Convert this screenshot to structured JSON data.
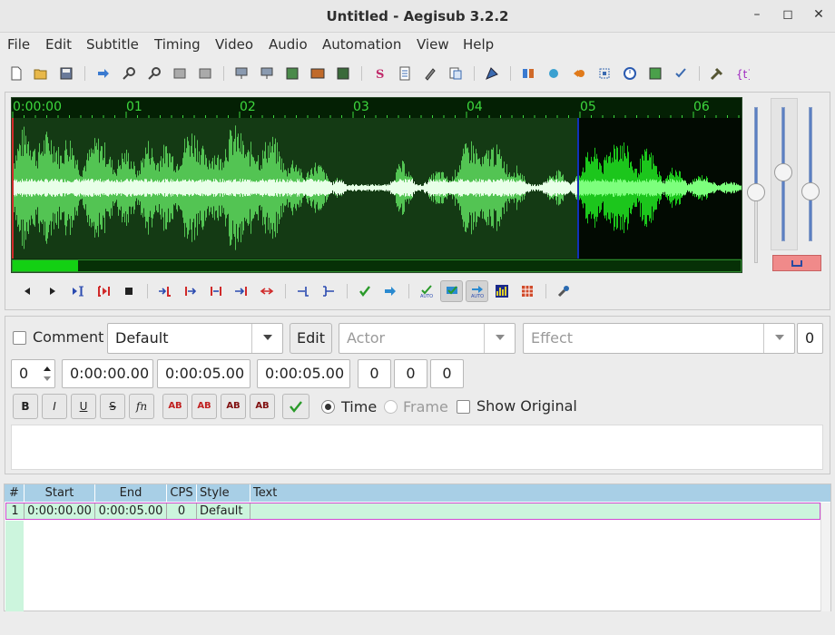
{
  "window": {
    "title": "Untitled - Aegisub 3.2.2"
  },
  "menu": [
    "File",
    "Edit",
    "Subtitle",
    "Timing",
    "Video",
    "Audio",
    "Automation",
    "View",
    "Help"
  ],
  "timeline": {
    "labels": [
      "0:00:00",
      "01",
      "02",
      "03",
      "04",
      "05",
      "06"
    ],
    "scroll_fraction": 0.09
  },
  "colors": {
    "waveform_bg": "#0b2f0b",
    "waveform_selected": "#53c453",
    "waveform_unselected": "#1cc61c",
    "marker": "#1230b8",
    "grid_header": "#a8cfe6",
    "grid_row": "#ccf5dd",
    "row_border": "#d04ad0"
  },
  "edit": {
    "comment_label": "Comment",
    "style_value": "Default",
    "edit_button": "Edit",
    "actor_placeholder": "Actor",
    "effect_placeholder": "Effect",
    "layer_value": "0",
    "line_value": "0",
    "start_time": "0:00:00.00",
    "end_time": "0:00:05.00",
    "duration": "0:00:05.00",
    "margin_left": "0",
    "margin_right": "0",
    "margin_vert": "0",
    "format_buttons": [
      "B",
      "I",
      "U",
      "S",
      "fn",
      "AB",
      "AB",
      "AB",
      "AB"
    ],
    "time_label": "Time",
    "frame_label": "Frame",
    "show_original_label": "Show Original",
    "text": ""
  },
  "grid": {
    "columns": [
      "#",
      "Start",
      "End",
      "CPS",
      "Style",
      "Text"
    ],
    "rows": [
      {
        "num": "1",
        "start": "0:00:00.00",
        "end": "0:00:05.00",
        "cps": "0",
        "style": "Default",
        "text": ""
      }
    ]
  },
  "icons": {
    "toolbar": [
      "new-file-icon",
      "open-file-icon",
      "save-file-icon",
      "jump-to-icon",
      "zoom-in-icon",
      "zoom-out-icon",
      "snap-start-icon",
      "snap-end-icon",
      "scene-icon",
      "video-details-icon",
      "properties-icon",
      "attachments-icon",
      "fonts-collector-icon",
      "styles-manager-icon",
      "resample-icon",
      "spell-check-icon",
      "timing-postprocessor-icon",
      "kanji-timer-icon",
      "translation-assistant-icon",
      "style-assistant-icon",
      "options-icon",
      "automation-icon"
    ],
    "audio": [
      "prev-line-icon",
      "next-line-icon",
      "play-selection-icon",
      "play-current-icon",
      "stop-icon",
      "play-before-icon",
      "play-start-icon",
      "play-end-icon",
      "play-after-icon",
      "play-to-end-icon",
      "set-start-icon",
      "set-end-icon",
      "commit-icon",
      "go-to-icon",
      "auto-commit-icon",
      "auto-scroll-icon",
      "auto-next-icon",
      "spectrum-icon",
      "karaoke-icon",
      "mic-icon"
    ]
  }
}
